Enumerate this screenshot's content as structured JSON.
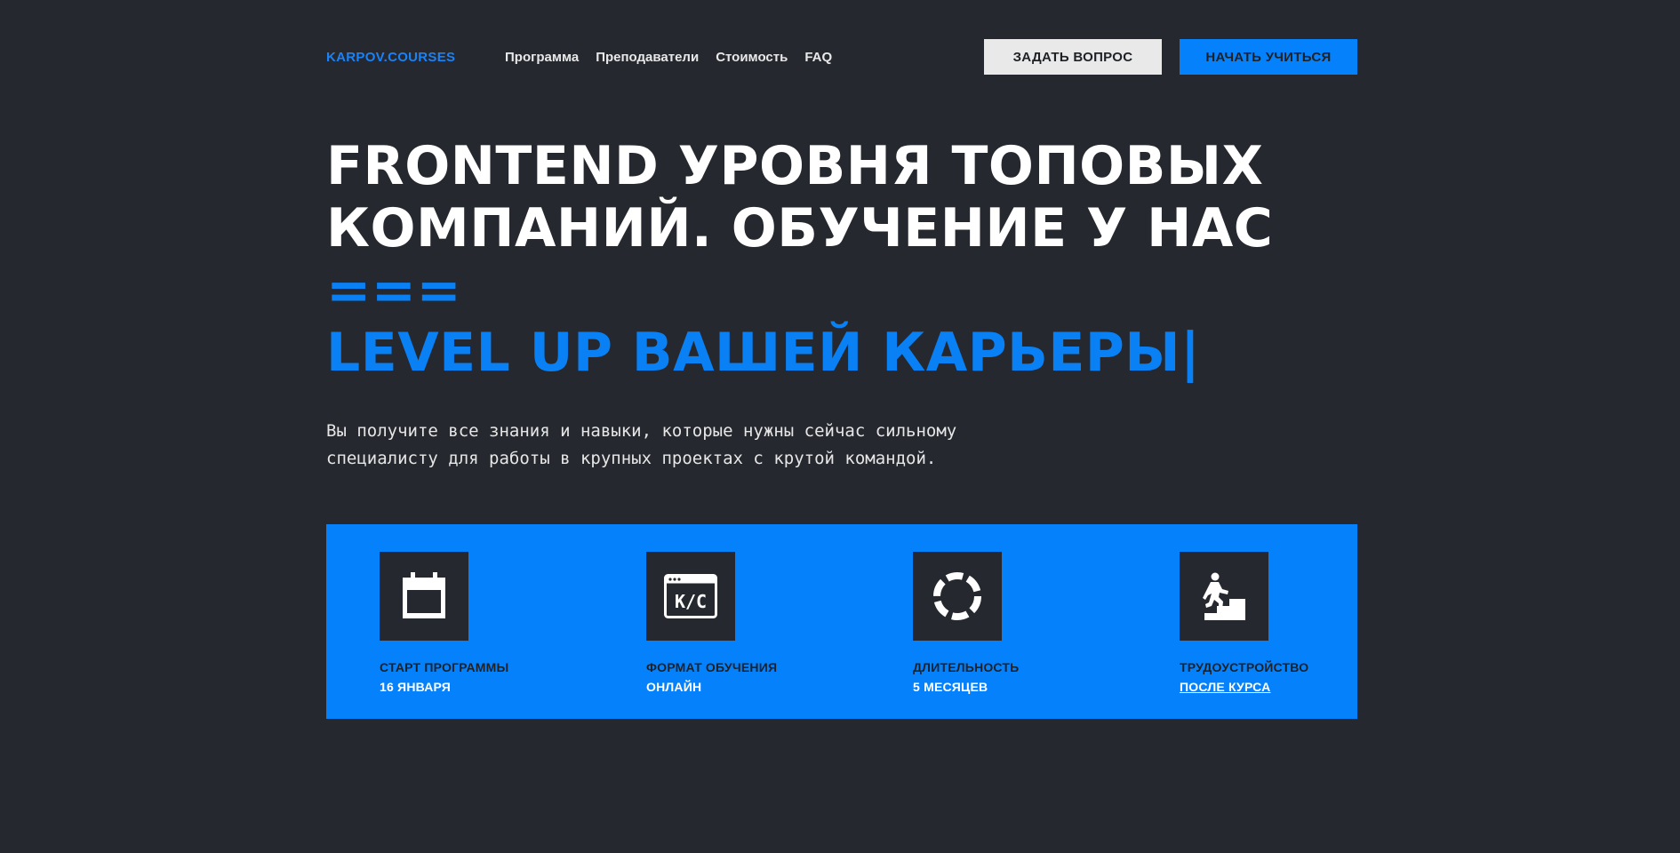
{
  "header": {
    "logo": "KARPOV.COURSES",
    "nav": [
      "Программа",
      "Преподаватели",
      "Стоимость",
      "FAQ"
    ],
    "ask_button": "ЗАДАТЬ ВОПРОС",
    "start_button": "НАЧАТЬ УЧИТЬСЯ"
  },
  "hero": {
    "title_line1": "FRONTEND УРОВНЯ ТОПОВЫХ",
    "title_line2": "КОМПАНИЙ. ОБУЧЕНИЕ У НАС ",
    "title_operator": "===",
    "title_line3": "LEVEL UP ВАШЕЙ КАРЬЕРЫ|",
    "description": "Вы получите все знания и навыки, которые нужны сейчас сильному специалисту для работы в крупных проектах с крутой командой."
  },
  "features": [
    {
      "icon": "calendar-icon",
      "label": "СТАРТ ПРОГРАММЫ",
      "value": "16 ЯНВАРЯ"
    },
    {
      "icon": "browser-kc-icon",
      "label": "ФОРМАТ ОБУЧЕНИЯ",
      "value": "ОНЛАЙН"
    },
    {
      "icon": "loading-ring-icon",
      "label": "ДЛИТЕЛЬНОСТЬ",
      "value": "5 МЕСЯЦЕВ"
    },
    {
      "icon": "stairs-climber-icon",
      "label": "ТРУДОУСТРОЙСТВО",
      "value": "ПОСЛЕ КУРСА"
    }
  ],
  "colors": {
    "background": "#25282e",
    "accent": "#0582fb",
    "text": "#ffffff"
  }
}
